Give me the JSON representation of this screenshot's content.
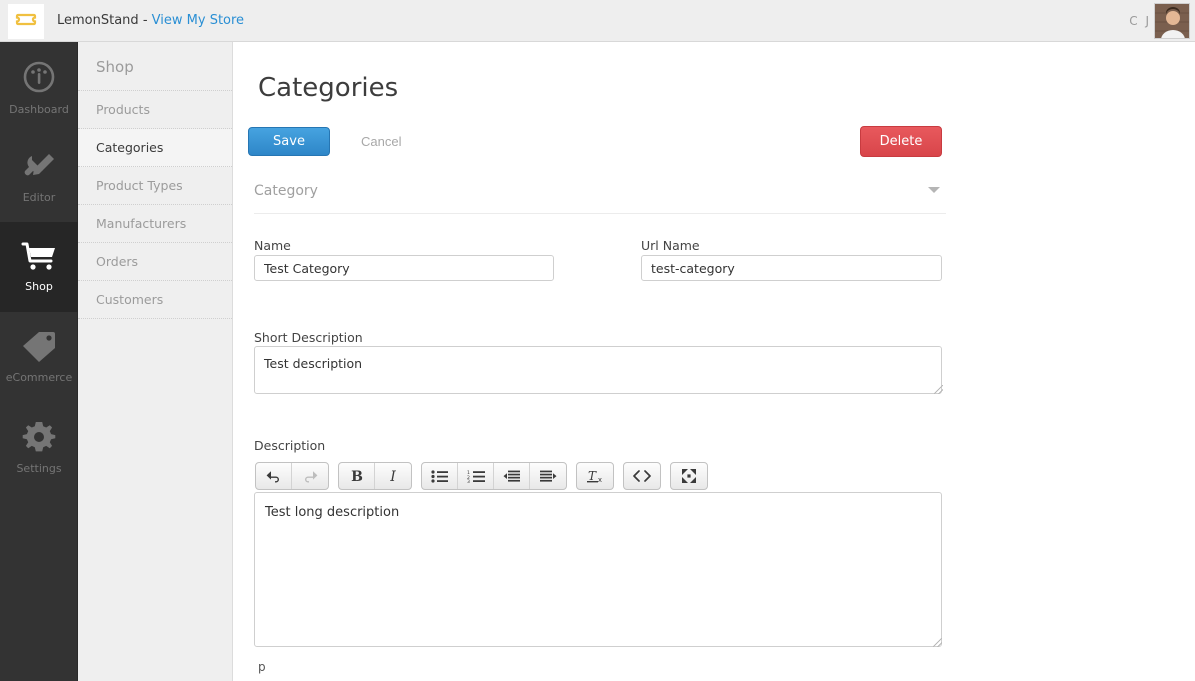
{
  "header": {
    "logo_icon": "lemonstand-logo-icon",
    "brand_name": "LemonStand",
    "separator": "-",
    "store_link": "View My Store",
    "user_initials": "C J",
    "avatar_icon": "user-avatar"
  },
  "primary_nav": {
    "items": [
      {
        "label": "Dashboard",
        "icon": "dashboard-gauge-icon",
        "active": false
      },
      {
        "label": "Editor",
        "icon": "wrench-pencil-icon",
        "active": false
      },
      {
        "label": "Shop",
        "icon": "shopping-cart-icon",
        "active": true
      },
      {
        "label": "eCommerce",
        "icon": "price-tag-icon",
        "active": false
      },
      {
        "label": "Settings",
        "icon": "gear-icon",
        "active": false
      }
    ]
  },
  "secondary_nav": {
    "title": "Shop",
    "items": [
      {
        "label": "Products",
        "active": false
      },
      {
        "label": "Categories",
        "active": true
      },
      {
        "label": "Product Types",
        "active": false
      },
      {
        "label": "Manufacturers",
        "active": false
      },
      {
        "label": "Orders",
        "active": false
      },
      {
        "label": "Customers",
        "active": false
      }
    ]
  },
  "main": {
    "page_title": "Categories",
    "toolbar": {
      "save_label": "Save",
      "cancel_label": "Cancel",
      "delete_label": "Delete"
    },
    "section": {
      "label": "Category",
      "chevron_icon": "chevron-down-icon"
    },
    "form": {
      "name": {
        "label": "Name",
        "value": "Test Category",
        "placeholder": ""
      },
      "url_name": {
        "label": "Url Name",
        "value": "test-category",
        "placeholder": ""
      },
      "short_description": {
        "label": "Short Description",
        "value": "Test description",
        "placeholder": ""
      },
      "description": {
        "label": "Description",
        "value": "Test long description",
        "path_indicator": "p"
      }
    },
    "editor_toolbar": {
      "groups": [
        {
          "buttons": [
            {
              "name": "undo-icon",
              "label": "Undo",
              "disabled": false
            },
            {
              "name": "redo-icon",
              "label": "Redo",
              "disabled": true
            }
          ]
        },
        {
          "buttons": [
            {
              "name": "bold-icon",
              "label": "Bold",
              "disabled": false
            },
            {
              "name": "italic-icon",
              "label": "Italic",
              "disabled": false
            }
          ]
        },
        {
          "buttons": [
            {
              "name": "unordered-list-icon",
              "label": "Bulleted List",
              "disabled": false
            },
            {
              "name": "ordered-list-icon",
              "label": "Numbered List",
              "disabled": false
            },
            {
              "name": "outdent-icon",
              "label": "Outdent",
              "disabled": false
            },
            {
              "name": "indent-icon",
              "label": "Indent",
              "disabled": false
            }
          ]
        },
        {
          "buttons": [
            {
              "name": "clear-formatting-icon",
              "label": "Remove Formatting",
              "disabled": false
            }
          ]
        },
        {
          "buttons": [
            {
              "name": "code-view-icon",
              "label": "Source Code",
              "disabled": false
            }
          ]
        },
        {
          "buttons": [
            {
              "name": "fullscreen-icon",
              "label": "Fullscreen",
              "disabled": false
            }
          ]
        }
      ]
    }
  },
  "colors": {
    "accent_blue": "#2e86c8",
    "danger_red": "#d8454a",
    "link_blue": "#2a8fd4",
    "logo_yellow": "#f0c040",
    "sidebar_dark": "#333333",
    "sidebar_active": "#262626"
  }
}
